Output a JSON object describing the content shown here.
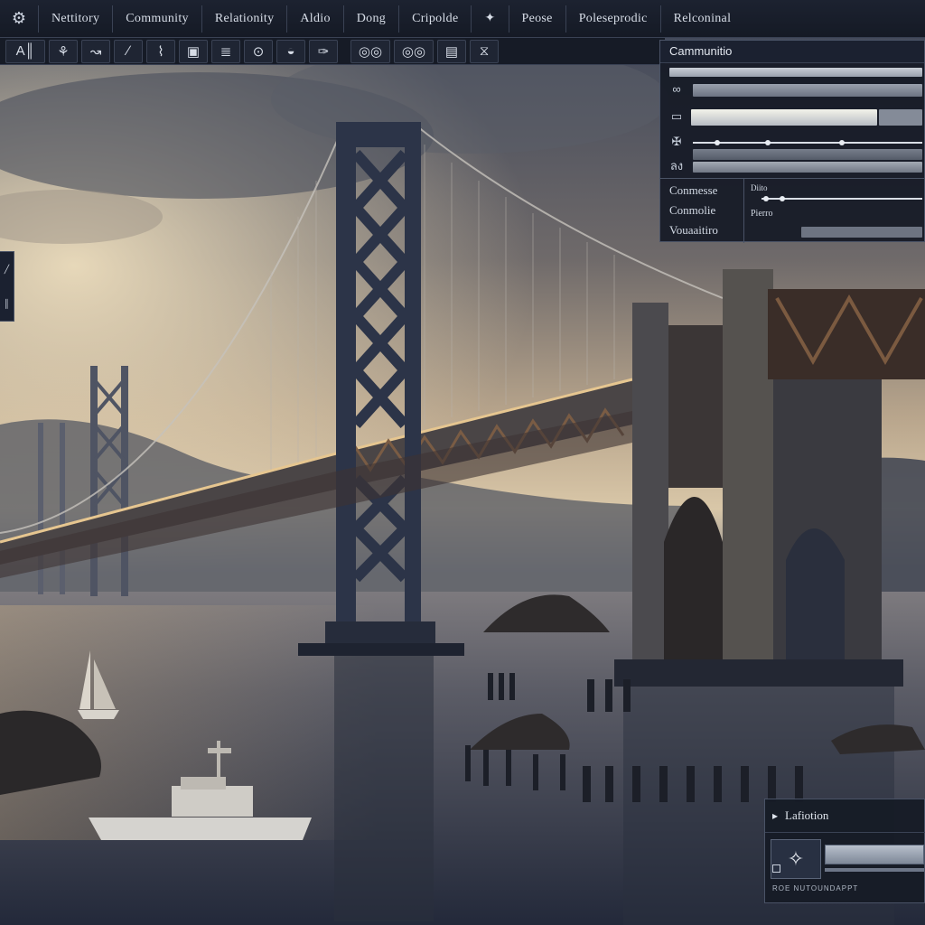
{
  "menu": {
    "logo_icon": "gear-icon",
    "items": [
      "Nettitory",
      "Community",
      "Relationity",
      "Aldio",
      "Dong",
      "Cripolde",
      "✦",
      "Peose",
      "Poleseprodic",
      "Relconinal"
    ]
  },
  "toolbar": {
    "tools": [
      "A║",
      "⚘",
      "↝",
      "∕",
      "⌇",
      "▣",
      "≣",
      "⊙",
      "◒",
      "✑",
      "◎◎",
      "◎◎",
      "▤",
      "⧖"
    ]
  },
  "right_panel": {
    "title": "Cammunitio",
    "row_icons": [
      "∞",
      "▭",
      "✠",
      "ลง"
    ],
    "labels": [
      "Conmesse",
      "Conmolie",
      "Vouaaitiro"
    ],
    "mini_labels": [
      "Diito",
      "Pierro"
    ]
  },
  "left_panel": {
    "marks": [
      "╱",
      "║"
    ]
  },
  "bottom_panel": {
    "title": "Lafiotion",
    "title_icon": "chevron-right-icon",
    "thumb_icon": "compass-icon",
    "footer": "ROE NUTOUNDAPPT"
  },
  "colors": {
    "panel_bg": "#161b26",
    "border": "#3a4254",
    "text": "#d8dee8"
  }
}
